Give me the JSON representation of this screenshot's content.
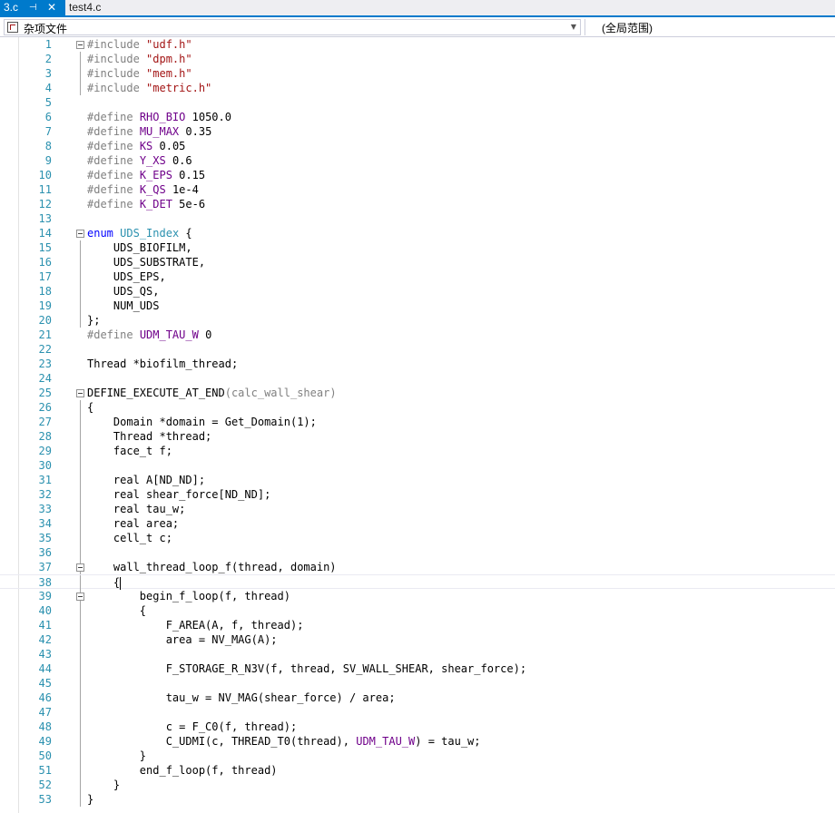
{
  "tabs": [
    {
      "label": "3.c",
      "active": true,
      "pin_icon": "pin-icon",
      "close_icon": "close-icon"
    },
    {
      "label": "test4.c",
      "active": false
    }
  ],
  "navbar": {
    "project": "杂项文件",
    "scope": "(全局范围)"
  },
  "colors": {
    "accent": "#007acc",
    "line_number": "#2b91af",
    "keyword": "#0000ff",
    "string": "#a31515",
    "macro": "#6f008a",
    "preprocessor": "#808080"
  },
  "editor": {
    "current_line": 38,
    "lines": [
      {
        "n": "1",
        "text": "#include \"udf.h\""
      },
      {
        "n": "2",
        "text": "#include \"dpm.h\""
      },
      {
        "n": "3",
        "text": "#include \"mem.h\""
      },
      {
        "n": "4",
        "text": "#include \"metric.h\""
      },
      {
        "n": "5",
        "text": ""
      },
      {
        "n": "6",
        "text": "#define RHO_BIO 1050.0"
      },
      {
        "n": "7",
        "text": "#define MU_MAX 0.35"
      },
      {
        "n": "8",
        "text": "#define KS 0.05"
      },
      {
        "n": "9",
        "text": "#define Y_XS 0.6"
      },
      {
        "n": "10",
        "text": "#define K_EPS 0.15"
      },
      {
        "n": "11",
        "text": "#define K_QS 1e-4"
      },
      {
        "n": "12",
        "text": "#define K_DET 5e-6"
      },
      {
        "n": "13",
        "text": ""
      },
      {
        "n": "14",
        "text": "enum UDS_Index {"
      },
      {
        "n": "15",
        "text": "    UDS_BIOFILM,"
      },
      {
        "n": "16",
        "text": "    UDS_SUBSTRATE,"
      },
      {
        "n": "17",
        "text": "    UDS_EPS,"
      },
      {
        "n": "18",
        "text": "    UDS_QS,"
      },
      {
        "n": "19",
        "text": "    NUM_UDS"
      },
      {
        "n": "20",
        "text": "};"
      },
      {
        "n": "21",
        "text": "#define UDM_TAU_W 0"
      },
      {
        "n": "22",
        "text": ""
      },
      {
        "n": "23",
        "text": "Thread *biofilm_thread;"
      },
      {
        "n": "24",
        "text": ""
      },
      {
        "n": "25",
        "text": "DEFINE_EXECUTE_AT_END(calc_wall_shear)"
      },
      {
        "n": "26",
        "text": "{"
      },
      {
        "n": "27",
        "text": "    Domain *domain = Get_Domain(1);"
      },
      {
        "n": "28",
        "text": "    Thread *thread;"
      },
      {
        "n": "29",
        "text": "    face_t f;"
      },
      {
        "n": "30",
        "text": ""
      },
      {
        "n": "31",
        "text": "    real A[ND_ND];"
      },
      {
        "n": "32",
        "text": "    real shear_force[ND_ND];"
      },
      {
        "n": "33",
        "text": "    real tau_w;"
      },
      {
        "n": "34",
        "text": "    real area;"
      },
      {
        "n": "35",
        "text": "    cell_t c;"
      },
      {
        "n": "36",
        "text": ""
      },
      {
        "n": "37",
        "text": "    wall_thread_loop_f(thread, domain)"
      },
      {
        "n": "38",
        "text": "    {"
      },
      {
        "n": "39",
        "text": "        begin_f_loop(f, thread)"
      },
      {
        "n": "40",
        "text": "        {"
      },
      {
        "n": "41",
        "text": "            F_AREA(A, f, thread);"
      },
      {
        "n": "42",
        "text": "            area = NV_MAG(A);"
      },
      {
        "n": "43",
        "text": ""
      },
      {
        "n": "44",
        "text": "            F_STORAGE_R_N3V(f, thread, SV_WALL_SHEAR, shear_force);"
      },
      {
        "n": "45",
        "text": ""
      },
      {
        "n": "46",
        "text": "            tau_w = NV_MAG(shear_force) / area;"
      },
      {
        "n": "47",
        "text": ""
      },
      {
        "n": "48",
        "text": "            c = F_C0(f, thread);"
      },
      {
        "n": "49",
        "text": "            C_UDMI(c, THREAD_T0(thread), UDM_TAU_W) = tau_w;"
      },
      {
        "n": "50",
        "text": "        }"
      },
      {
        "n": "51",
        "text": "        end_f_loop(f, thread)"
      },
      {
        "n": "52",
        "text": "    }"
      },
      {
        "n": "53",
        "text": "}"
      }
    ]
  }
}
